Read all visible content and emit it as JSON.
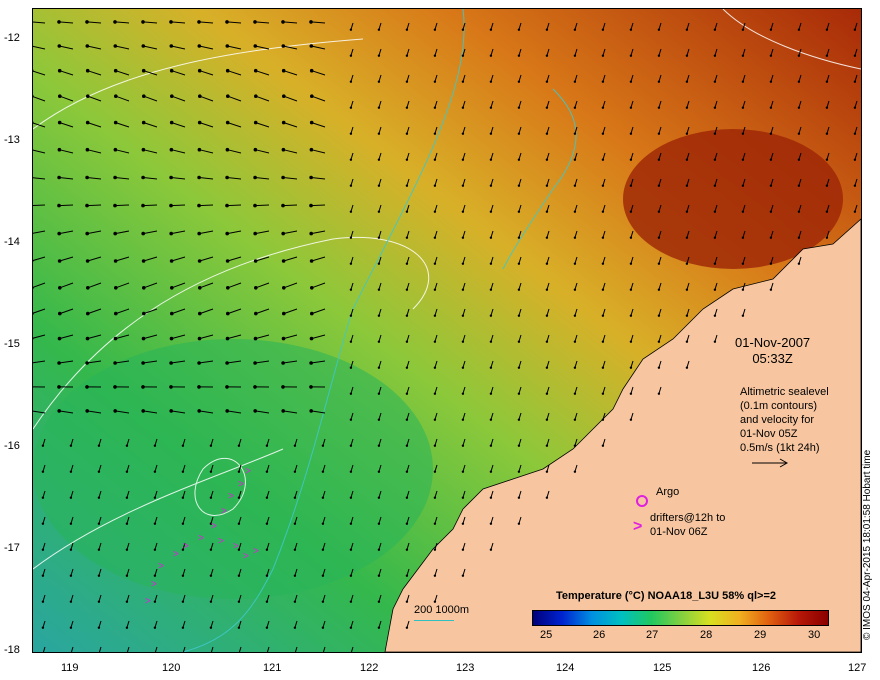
{
  "map": {
    "lat_ticks": [
      "-12",
      "-13",
      "-14",
      "-15",
      "-16",
      "-17",
      "-18"
    ],
    "lon_ticks": [
      "119",
      "120",
      "121",
      "122",
      "123",
      "124",
      "125",
      "126",
      "127"
    ],
    "date_line1": "01-Nov-2007",
    "date_line2": "05:33Z",
    "alt_lines": [
      "Altimetric sealevel",
      "(0.1m contours)",
      "and velocity for",
      "01-Nov 05Z",
      "0.5m/s (1kt 24h)"
    ],
    "argo_label": "Argo",
    "drifter_line1": "drifters@12h to",
    "drifter_line2": "01-Nov 06Z",
    "scale_label": "200  1000m",
    "colorbar_title": "Temperature (°C) NOAA18_L3U 58% ql>=2",
    "colorbar_ticks": [
      "25",
      "26",
      "27",
      "28",
      "29",
      "30"
    ],
    "credit": "© IMOS 04-Apr-2015 18:01:58 Hobart time",
    "colors": {
      "land": "#f7c6a0",
      "cool": "#22b45a",
      "warm": "#d97a18",
      "hot": "#a82a08",
      "drifter": "#e020e0",
      "contour": "#ffffff"
    }
  }
}
